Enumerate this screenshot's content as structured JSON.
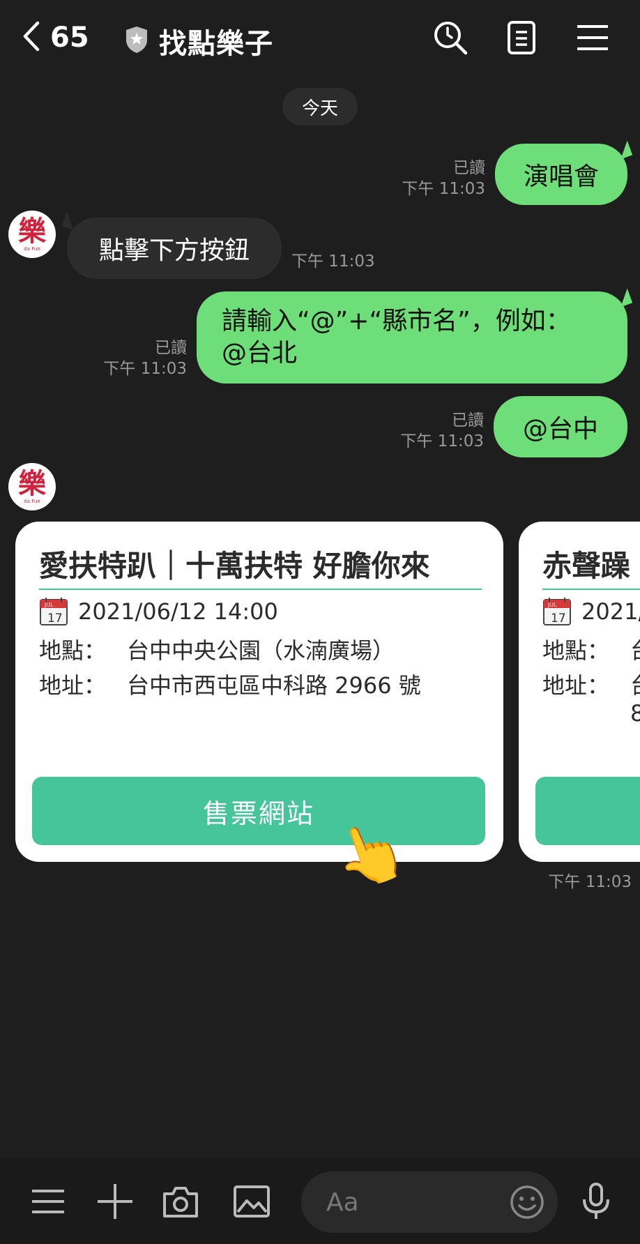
{
  "header": {
    "back_count": "65",
    "title": "找點樂子",
    "icons": [
      "search-icon",
      "notes-icon",
      "menu-icon"
    ]
  },
  "date_divider": "今天",
  "messages": [
    {
      "dir": "out",
      "text": "演唱會",
      "read": "已讀",
      "time": "下午 11:03"
    },
    {
      "dir": "in",
      "text": "點擊下方按鈕",
      "time": "下午 11:03"
    },
    {
      "dir": "out",
      "line1": "請輸入“@”+“縣市名”，例如：",
      "line2": "@台北",
      "read": "已讀",
      "time": "下午 11:03"
    },
    {
      "dir": "out",
      "text": "@台中",
      "read": "已讀",
      "time": "下午 11:03"
    }
  ],
  "avatar": {
    "glyph": "樂",
    "sub": "da Fun"
  },
  "cards": [
    {
      "title": "愛扶特趴｜十萬扶特 好膽你來",
      "datetime": "2021/06/12 14:00",
      "place_label": "地點：",
      "place": "台中中央公園（水湳廣場）",
      "addr_label": "地址：",
      "addr": "台中市西屯區中科路 2966 號",
      "button": "售票網站"
    },
    {
      "title": "赤聲躁",
      "datetime": "2021/",
      "place_label": "地點：",
      "place": "台",
      "addr_label": "地址：",
      "addr": "台",
      "addr2": "8"
    }
  ],
  "cards_time": "下午 11:03",
  "calendar_month": "JUL",
  "calendar_day": "17",
  "input": {
    "placeholder": "Aa"
  },
  "colors": {
    "bubble_out": "#6ede79",
    "accent": "#47c59a",
    "background": "#1e1e1e"
  }
}
